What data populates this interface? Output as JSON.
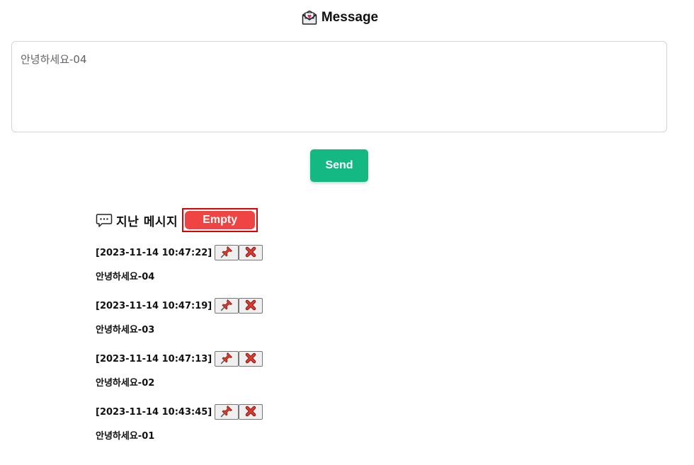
{
  "header": {
    "title": "Message",
    "icon": "love-letter-icon"
  },
  "composer": {
    "value": "안녕하세요-04",
    "send_label": "Send",
    "accent": "#14b882"
  },
  "history": {
    "title": "지난 메시지",
    "icon": "speech-bubble-icon",
    "empty_label": "Empty",
    "empty_color": "#ef4444",
    "messages": [
      {
        "timestamp": "[2023-11-14 10:47:22]",
        "text": "안녕하세요-04"
      },
      {
        "timestamp": "[2023-11-14 10:47:19]",
        "text": "안녕하세요-03"
      },
      {
        "timestamp": "[2023-11-14 10:47:13]",
        "text": "안녕하세요-02"
      },
      {
        "timestamp": "[2023-11-14 10:43:45]",
        "text": "안녕하세요-01"
      }
    ]
  }
}
